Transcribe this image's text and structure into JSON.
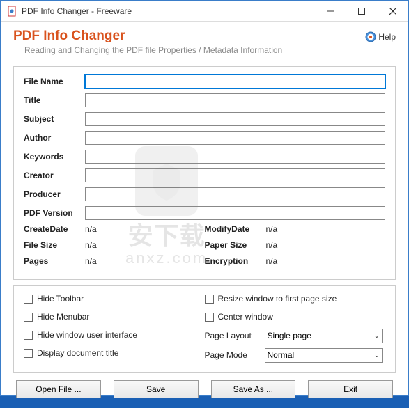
{
  "window": {
    "title": "PDF Info Changer - Freeware"
  },
  "header": {
    "title": "PDF Info Changer",
    "subtitle": "Reading and Changing the PDF file Properties / Metadata Information",
    "help": "Help"
  },
  "fields": {
    "filename": {
      "label": "File Name",
      "value": ""
    },
    "title": {
      "label": "Title",
      "value": ""
    },
    "subject": {
      "label": "Subject",
      "value": ""
    },
    "author": {
      "label": "Author",
      "value": ""
    },
    "keywords": {
      "label": "Keywords",
      "value": ""
    },
    "creator": {
      "label": "Creator",
      "value": ""
    },
    "producer": {
      "label": "Producer",
      "value": ""
    },
    "pdfversion": {
      "label": "PDF Version",
      "value": ""
    }
  },
  "info": {
    "createdate": {
      "label": "CreateDate",
      "value": "n/a"
    },
    "filesize": {
      "label": "File Size",
      "value": "n/a"
    },
    "pages": {
      "label": "Pages",
      "value": "n/a"
    },
    "modifydate": {
      "label": "ModifyDate",
      "value": "n/a"
    },
    "papersize": {
      "label": "Paper Size",
      "value": "n/a"
    },
    "encryption": {
      "label": "Encryption",
      "value": "n/a"
    }
  },
  "options": {
    "hide_toolbar": "Hide Toolbar",
    "hide_menubar": "Hide Menubar",
    "hide_window_ui": "Hide window user interface",
    "display_doc_title": "Display document title",
    "resize_window": "Resize window to first page size",
    "center_window": "Center window",
    "page_layout": {
      "label": "Page Layout",
      "value": "Single page"
    },
    "page_mode": {
      "label": "Page Mode",
      "value": "Normal"
    }
  },
  "buttons": {
    "open": "pen File ...",
    "open_ul": "O",
    "save": "ave",
    "save_ul": "S",
    "saveas": "Save ",
    "saveas_ul": "A",
    "saveas_suffix": "s ...",
    "exit": "E",
    "exit_ul": "x",
    "exit_suffix": "it"
  },
  "watermark": {
    "text": "安下载",
    "sub": "anxz.com"
  }
}
